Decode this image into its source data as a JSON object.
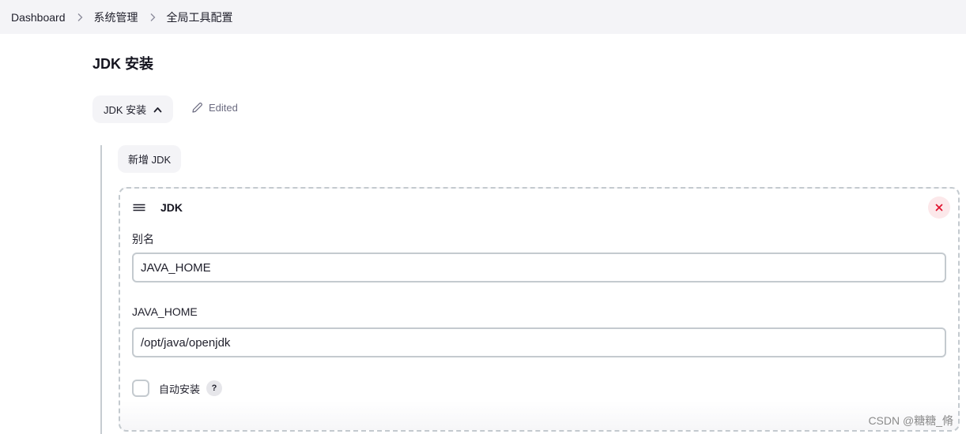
{
  "breadcrumb": {
    "items": [
      {
        "label": "Dashboard"
      },
      {
        "label": "系统管理"
      },
      {
        "label": "全局工具配置"
      }
    ]
  },
  "page": {
    "title": "JDK 安装"
  },
  "section": {
    "toggle_label": "JDK 安装",
    "toggle_icon": "chevron-up-icon",
    "edited_label": "Edited",
    "edited_icon": "pencil-icon",
    "add_button_label": "新增 JDK"
  },
  "jdk_entry": {
    "title": "JDK",
    "drag_icon": "hamburger-drag-icon",
    "delete_icon": "close-icon",
    "fields": {
      "alias": {
        "label": "别名",
        "value": "JAVA_HOME"
      },
      "java_home": {
        "label": "JAVA_HOME",
        "value": "/opt/java/openjdk"
      }
    },
    "auto_install": {
      "label": "自动安装",
      "checked": false,
      "help": "?"
    }
  },
  "watermark": "CSDN @糖糖_脩",
  "colors": {
    "breadcrumb_bg": "#f4f4f7",
    "button_bg": "#f4f4f7",
    "border": "#c4cacf",
    "delete_bg": "#fce8ea",
    "delete_fg": "#e0132e"
  }
}
